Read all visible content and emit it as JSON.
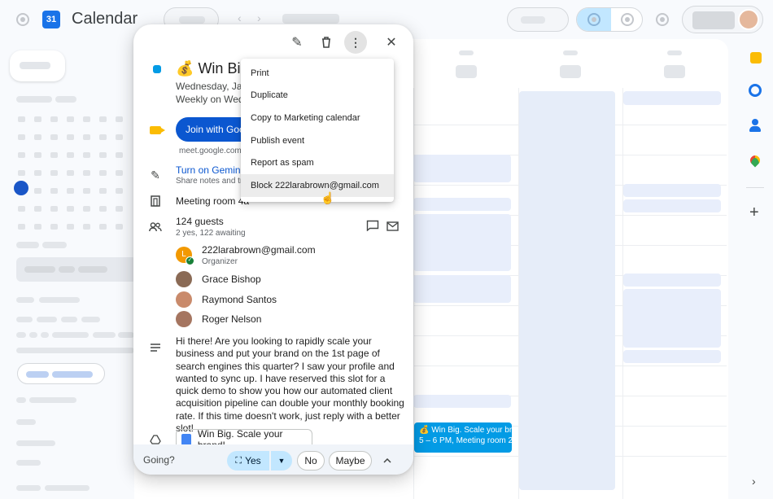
{
  "header": {
    "app_title": "Calendar",
    "logo_text": "31"
  },
  "event": {
    "title": "Win Big",
    "emoji": "💰",
    "date_line": "Wednesday, Jan",
    "recurrence": "Weekly on Wedn",
    "color": "#039be5"
  },
  "popup_actions": {
    "edit_icon": "pencil-icon",
    "delete_icon": "trash-icon",
    "options_icon": "more-vert-icon",
    "close_icon": "close-icon"
  },
  "meet": {
    "join_label": "Join with Goo",
    "link": "meet.google.com/"
  },
  "gemini": {
    "title": "Turn on Gemini",
    "subtitle": "Share notes and tra"
  },
  "room": "Meeting room 4a",
  "guests": {
    "count_label": "124 guests",
    "summary": "2 yes, 122 awaiting",
    "list": [
      {
        "name": "222larabrown@gmail.com",
        "role": "Organizer",
        "avatar_letter": "L"
      },
      {
        "name": "Grace Bishop"
      },
      {
        "name": "Raymond Santos"
      },
      {
        "name": "Roger Nelson"
      }
    ]
  },
  "description": "Hi there! Are you looking to rapidly scale your business and put your brand on the 1st page of search engines this quarter? I saw your profile and wanted to sync up. I have reserved this slot for a quick demo to show you how our automated client acquisition pipeline can double your monthly booking rate. If this time doesn't work, just reply with a better slot!",
  "attachment": "Win Big. Scale your brand!",
  "rsvp": {
    "going_label": "Going?",
    "yes": "Yes",
    "no": "No",
    "maybe": "Maybe"
  },
  "menu": {
    "items": [
      "Print",
      "Duplicate",
      "Copy to Marketing calendar",
      "Publish event",
      "Report as spam",
      "Block 222larabrown@gmail.com"
    ]
  },
  "calendar_event_chip": {
    "title": "💰 Win Big. Scale your bra",
    "detail": "5 – 6 PM, Meeting room 2c"
  },
  "colors": {
    "accent": "#0b57d0",
    "event": "#039be5",
    "selected_day": "#1a56c7"
  }
}
